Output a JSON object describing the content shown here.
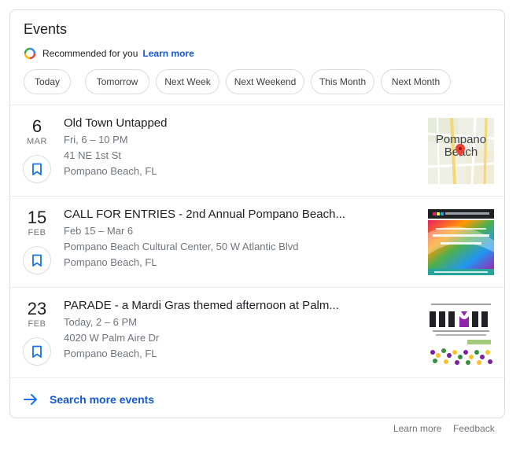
{
  "card": {
    "title": "Events",
    "recommended_text": "Recommended for you",
    "learn_more_link": "Learn more",
    "search_more": "Search more events"
  },
  "chips": [
    "Today",
    "Tomorrow",
    "Next Week",
    "Next Weekend",
    "This Month",
    "Next Month"
  ],
  "events": [
    {
      "day": "6",
      "month": "MAR",
      "title": "Old Town Untapped",
      "time": "Fri, 6 – 10 PM",
      "address": "41 NE 1st St",
      "city": "Pompano Beach, FL",
      "thumb_label": "Pompano Beach"
    },
    {
      "day": "15",
      "month": "FEB",
      "title": "CALL FOR ENTRIES - 2nd Annual Pompano Beach...",
      "time": "Feb 15 – Mar 6",
      "address": "Pompano Beach Cultural Center, 50 W Atlantic Blvd",
      "city": "Pompano Beach, FL"
    },
    {
      "day": "23",
      "month": "FEB",
      "title": "PARADE - a Mardi Gras themed afternoon at Palm...",
      "time": "Today, 2 – 6 PM",
      "address": "4020 W Palm Aire Dr",
      "city": "Pompano Beach, FL"
    }
  ],
  "footer": {
    "learn_more": "Learn more",
    "feedback": "Feedback"
  },
  "colors": {
    "link_blue": "#1558d6",
    "secondary_text": "#70757a",
    "border": "#dadce0"
  }
}
